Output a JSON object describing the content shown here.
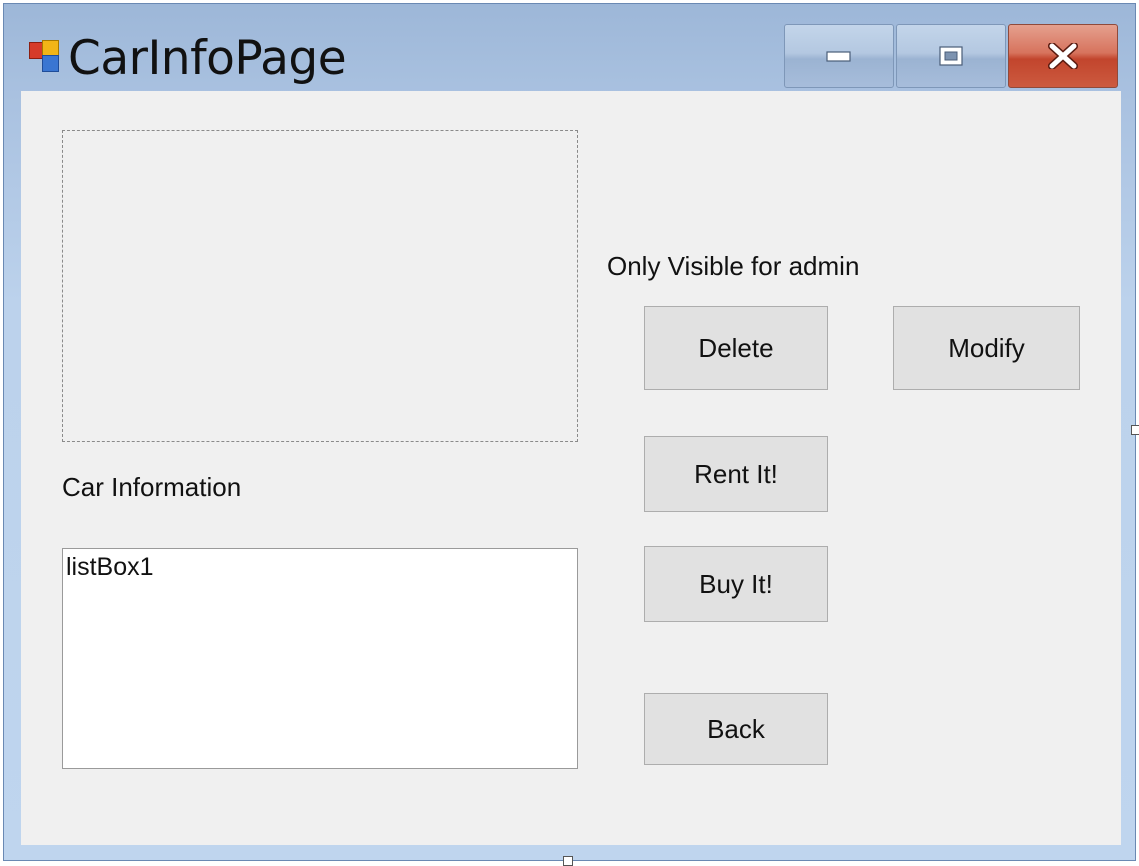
{
  "window": {
    "title": "CarInfoPage",
    "icon": "windows-forms-app-icon",
    "controls": {
      "minimize_icon": "minimize-icon",
      "maximize_icon": "maximize-icon",
      "close_icon": "close-icon"
    }
  },
  "form": {
    "admin_label": "Only Visible for admin",
    "car_info_label": "Car Information",
    "listbox": {
      "items": [
        "listBox1"
      ]
    },
    "buttons": {
      "delete": "Delete",
      "modify": "Modify",
      "rent": "Rent It!",
      "buy": "Buy It!",
      "back": "Back"
    }
  },
  "colors": {
    "titlebar": "#a9c1e0",
    "client": "#f0f0f0",
    "button": "#e1e1e1",
    "close_button": "#c7452d"
  }
}
